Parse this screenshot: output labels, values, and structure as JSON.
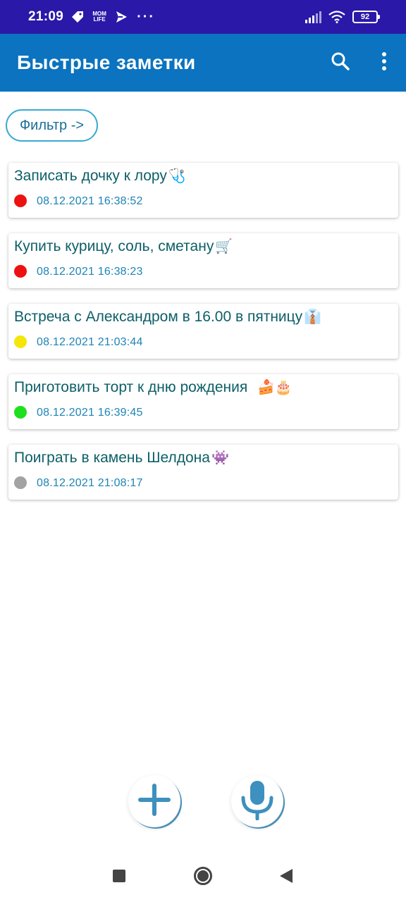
{
  "status_bar": {
    "time": "21:09",
    "app_badge_text": "MOM\nLIFE",
    "more_dots": "···",
    "battery_level": "92"
  },
  "app_bar": {
    "title": "Быстрые заметки",
    "search_icon": "search-icon",
    "menu_icon": "more-vert-icon"
  },
  "filter": {
    "label": "Фильтр ->"
  },
  "notes": [
    {
      "title": "Записать дочку к лору",
      "emoji": "🩺",
      "date": "08.12.2021 16:38:52",
      "priority_color": "#ee1111"
    },
    {
      "title": "Купить курицу, соль, сметану",
      "emoji": "🛒",
      "date": "08.12.2021 16:38:23",
      "priority_color": "#ee1111"
    },
    {
      "title": "Встреча с Александром в 16.00 в пятницу",
      "emoji": "👔",
      "date": "08.12.2021 21:03:44",
      "priority_color": "#f5e60a"
    },
    {
      "title": "Приготовить торт к дню рождения",
      "emoji": "🍰🎂",
      "date": "08.12.2021 16:39:45",
      "priority_color": "#1ee01e"
    },
    {
      "title": "Поиграть в камень Шелдона",
      "emoji": "👾",
      "date": "08.12.2021 21:08:17",
      "priority_color": "#a3a3a3"
    }
  ],
  "fabs": {
    "add_icon": "plus-icon",
    "mic_icon": "microphone-icon"
  },
  "nav": {
    "recents_icon": "square-icon",
    "home_icon": "circle-icon",
    "back_icon": "triangle-back-icon"
  },
  "colors": {
    "status_bar": "#2a18a8",
    "app_bar": "#0b73bf",
    "accent": "#3aaad2",
    "note_title": "#0d5f68",
    "note_date": "#1d84b5"
  }
}
